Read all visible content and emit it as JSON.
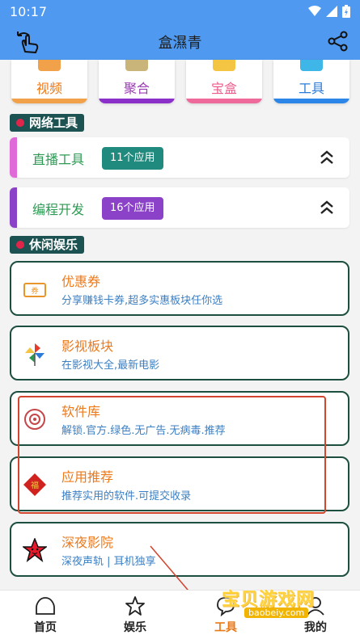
{
  "status": {
    "time": "10:17"
  },
  "appbar": {
    "title": "盒濕青"
  },
  "categories": [
    {
      "label": "视频",
      "color": "#ec7a1c",
      "bar": "#f1a14a"
    },
    {
      "label": "聚合",
      "color": "#9b3db3",
      "bar": "#8b30c9"
    },
    {
      "label": "宝盒",
      "color": "#ec5a8a",
      "bar": "#ee6a9a"
    },
    {
      "label": "工具",
      "color": "#2a7cd8",
      "bar": "#2c86e8"
    }
  ],
  "sections": {
    "network": "网络工具",
    "leisure": "休闲娱乐"
  },
  "tools": [
    {
      "title": "直播工具",
      "badge": "11个应用",
      "title_color": "#2d9a54",
      "stripe": "#e06bd8",
      "badge_color": "#1f8a7d"
    },
    {
      "title": "编程开发",
      "badge": "16个应用",
      "title_color": "#2d9a54",
      "stripe": "#8b42c9",
      "badge_color": "#8b42c9"
    }
  ],
  "cards": [
    {
      "title": "优惠券",
      "subtitle": "分享赚钱卡券,超多实惠板块任你选",
      "icon": "ticket-icon"
    },
    {
      "title": "影视板块",
      "subtitle": "在影视大全,最新电影",
      "icon": "pinwheel-icon"
    },
    {
      "title": "软件库",
      "subtitle": "解锁.官方.绿色.无广告.无病毒.推荐",
      "icon": "disc-icon"
    },
    {
      "title": "应用推荐",
      "subtitle": "推荐实用的软件.可提交收录",
      "icon": "fu-diamond-icon"
    },
    {
      "title": "深夜影院",
      "subtitle": "深夜声轨 | 耳机独享",
      "icon": "star-face-icon"
    }
  ],
  "nav": [
    {
      "label": "首页",
      "icon": "home-icon"
    },
    {
      "label": "娱乐",
      "icon": "star-icon"
    },
    {
      "label": "工具",
      "icon": "chat-icon",
      "active": true
    },
    {
      "label": "我的",
      "icon": "person-icon"
    }
  ],
  "watermark": {
    "text": "宝贝游戏网",
    "url": "baobeiy.com"
  }
}
